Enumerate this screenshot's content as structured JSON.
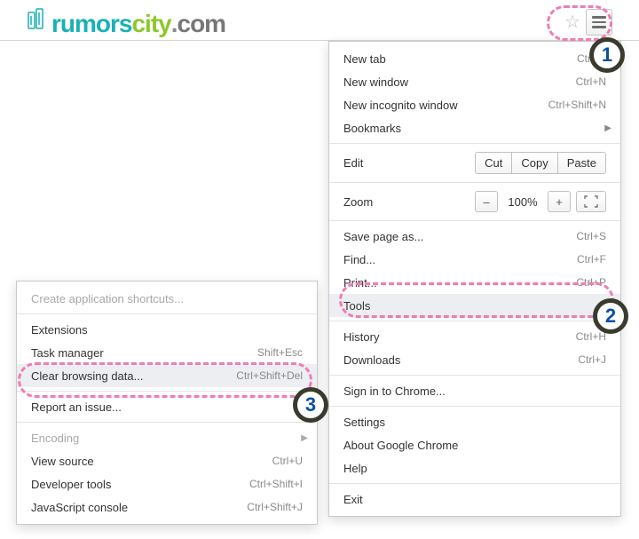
{
  "logo": {
    "brand1": "rumors",
    "brand2": "city",
    "brand3": ".",
    "brand4": "com"
  },
  "menu": {
    "new_tab": "New tab",
    "new_tab_sc": "Ctrl+T",
    "new_window": "New window",
    "new_window_sc": "Ctrl+N",
    "new_incog": "New incognito window",
    "new_incog_sc": "Ctrl+Shift+N",
    "bookmarks": "Bookmarks",
    "edit": "Edit",
    "cut": "Cut",
    "copy": "Copy",
    "paste": "Paste",
    "zoom": "Zoom",
    "zoom_minus": "–",
    "zoom_val": "100%",
    "zoom_plus": "+",
    "save_page": "Save page as...",
    "save_page_sc": "Ctrl+S",
    "find": "Find...",
    "find_sc": "Ctrl+F",
    "print": "Print...",
    "print_sc": "Ctrl+P",
    "tools": "Tools",
    "history": "History",
    "history_sc": "Ctrl+H",
    "downloads": "Downloads",
    "downloads_sc": "Ctrl+J",
    "signin": "Sign in to Chrome...",
    "settings": "Settings",
    "about": "About Google Chrome",
    "help": "Help",
    "exit": "Exit"
  },
  "tools": {
    "create_shortcuts": "Create application shortcuts...",
    "extensions": "Extensions",
    "task_manager": "Task manager",
    "task_manager_sc": "Shift+Esc",
    "clear_data": "Clear browsing data...",
    "clear_data_sc": "Ctrl+Shift+Del",
    "report_issue": "Report an issue...",
    "encoding": "Encoding",
    "view_source": "View source",
    "view_source_sc": "Ctrl+U",
    "dev_tools": "Developer tools",
    "dev_tools_sc": "Ctrl+Shift+I",
    "js_console": "JavaScript console",
    "js_console_sc": "Ctrl+Shift+J"
  },
  "annotations": {
    "n1": "1",
    "n2": "2",
    "n3": "3"
  }
}
